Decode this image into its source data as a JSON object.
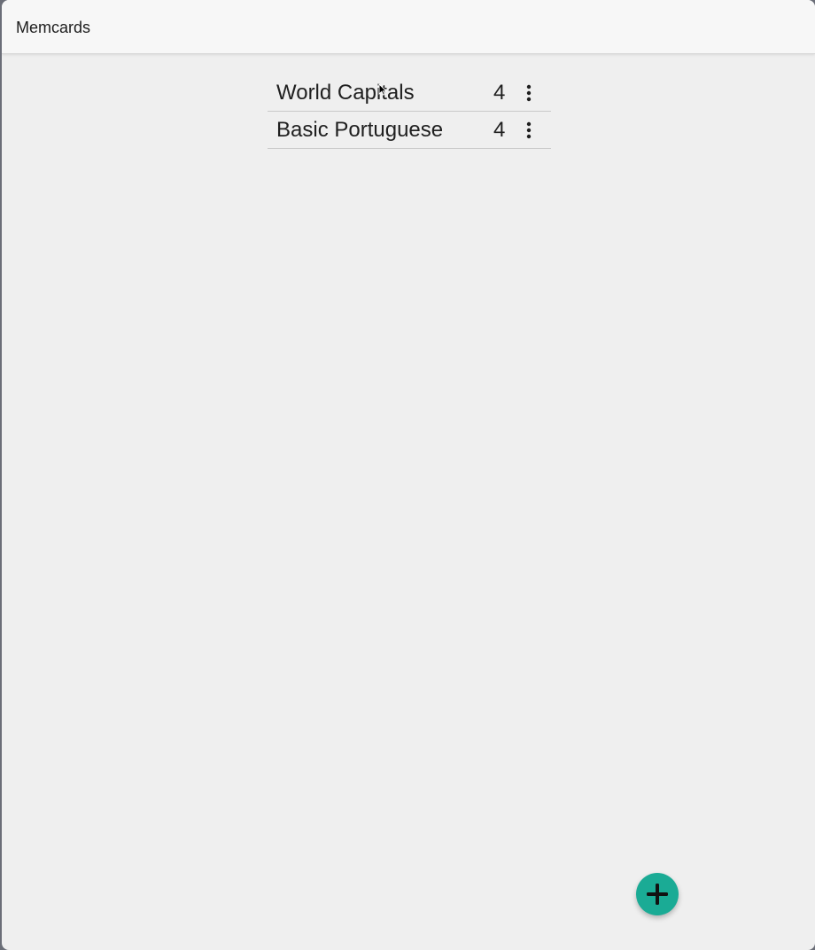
{
  "app": {
    "title": "Memcards"
  },
  "decks": [
    {
      "name": "World Capitals",
      "count": "4"
    },
    {
      "name": "Basic Portuguese",
      "count": "4"
    }
  ],
  "icons": {
    "deck_menu": "more-vertical-icon",
    "fab": "plus-icon"
  },
  "colors": {
    "accent": "#1aab95",
    "background": "#efefef",
    "titlebar": "#f7f7f7"
  }
}
